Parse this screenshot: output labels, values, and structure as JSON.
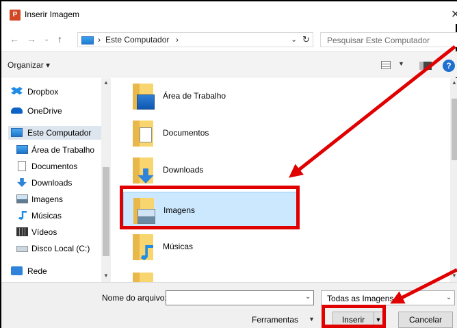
{
  "window": {
    "app_icon": "powerpoint-icon",
    "title": "Inserir Imagem",
    "close_label": "✕"
  },
  "address": {
    "crumbs": [
      "Este Computador"
    ],
    "search_placeholder": "Pesquisar Este Computador"
  },
  "toolbar": {
    "organize_label": "Organizar ▾",
    "help_label": "?"
  },
  "sidebar": {
    "items": [
      {
        "label": "Dropbox",
        "icon": "dropbox-icon"
      },
      {
        "label": "OneDrive",
        "icon": "onedrive-icon"
      },
      {
        "label": "Este Computador",
        "icon": "computer-icon",
        "selected": true
      },
      {
        "label": "Área de Trabalho",
        "icon": "desktop-icon"
      },
      {
        "label": "Documentos",
        "icon": "documents-icon"
      },
      {
        "label": "Downloads",
        "icon": "downloads-icon"
      },
      {
        "label": "Imagens",
        "icon": "pictures-icon"
      },
      {
        "label": "Músicas",
        "icon": "music-icon"
      },
      {
        "label": "Vídeos",
        "icon": "videos-icon"
      },
      {
        "label": "Disco Local (C:)",
        "icon": "disk-icon"
      },
      {
        "label": "Rede",
        "icon": "network-icon"
      }
    ]
  },
  "files": [
    {
      "name": "Área de Trabalho",
      "icon": "desktop-folder-icon"
    },
    {
      "name": "Documentos",
      "icon": "documents-folder-icon"
    },
    {
      "name": "Downloads",
      "icon": "downloads-folder-icon"
    },
    {
      "name": "Imagens",
      "icon": "pictures-folder-icon",
      "selected": true
    },
    {
      "name": "Músicas",
      "icon": "music-folder-icon"
    }
  ],
  "bottom": {
    "filename_label": "Nome do arquivo:",
    "filename_value": "",
    "filter_value": "Todas as Imagens",
    "tools_label": "Ferramentas",
    "insert_label": "Inserir",
    "cancel_label": "Cancelar"
  },
  "annotations": {
    "color": "#e00000"
  }
}
